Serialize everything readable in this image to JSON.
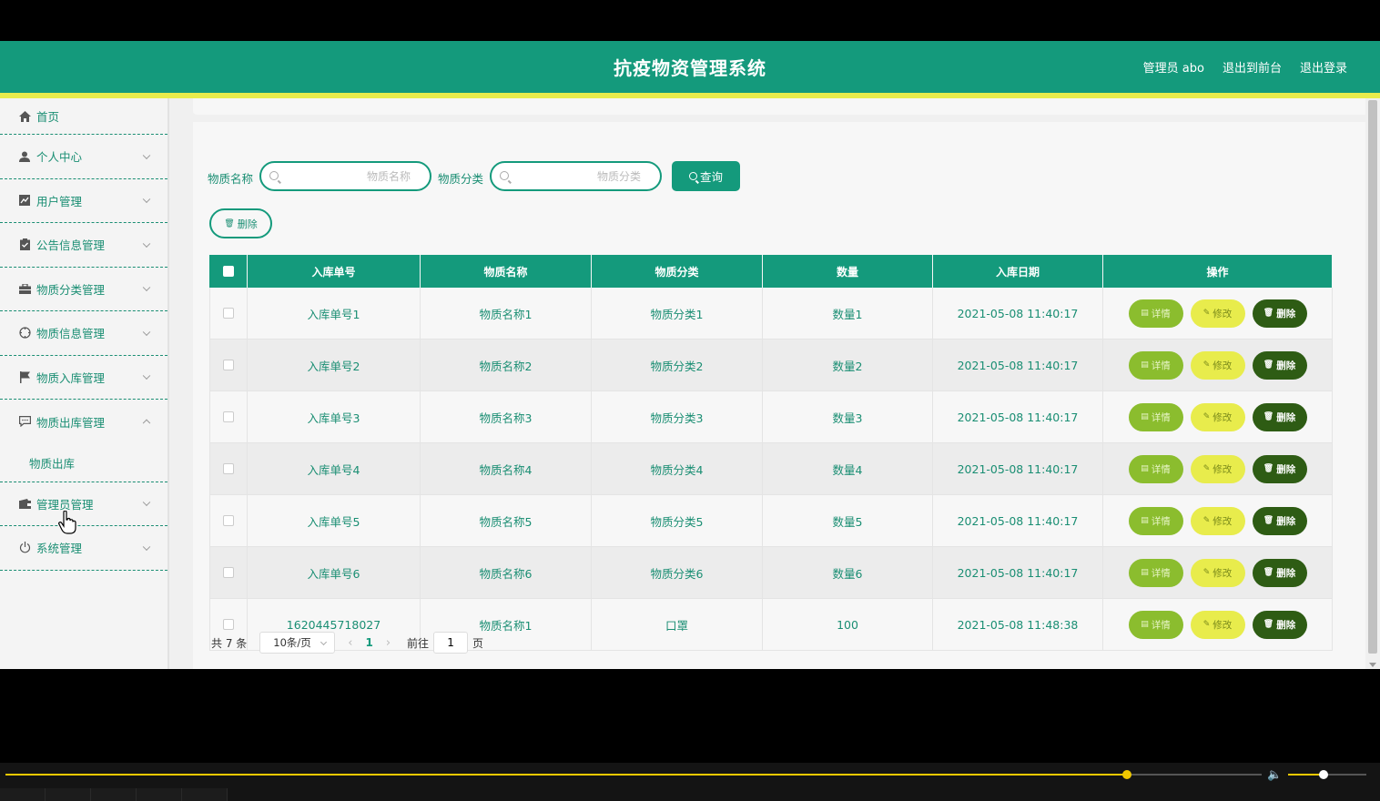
{
  "header": {
    "title": "抗疫物资管理系统",
    "user_label": "管理员 abo",
    "front_link": "退出到前台",
    "logout_link": "退出登录",
    "colors": {
      "primary": "#149a7c",
      "accent": "#e8ec4c"
    }
  },
  "sidebar": {
    "items": [
      {
        "label": "首页",
        "icon": "home-icon"
      },
      {
        "label": "个人中心",
        "icon": "user-icon"
      },
      {
        "label": "用户管理",
        "icon": "chart-icon"
      },
      {
        "label": "公告信息管理",
        "icon": "clipboard-icon"
      },
      {
        "label": "物质分类管理",
        "icon": "briefcase-icon"
      },
      {
        "label": "物质信息管理",
        "icon": "compass-icon"
      },
      {
        "label": "物质入库管理",
        "icon": "flag-icon"
      },
      {
        "label": "物质出库管理",
        "icon": "comment-icon"
      },
      {
        "label": "管理员管理",
        "icon": "wallet-icon"
      },
      {
        "label": "系统管理",
        "icon": "power-icon"
      }
    ],
    "sub_item": "物质出库"
  },
  "search": {
    "name_label": "物质名称",
    "name_placeholder": "物质名称",
    "category_label": "物质分类",
    "category_placeholder": "物质分类",
    "query_button": "查询"
  },
  "bulk_delete": "删除",
  "table": {
    "headers": [
      "入库单号",
      "物质名称",
      "物质分类",
      "数量",
      "入库日期",
      "操作"
    ],
    "rows": [
      [
        "入库单号1",
        "物质名称1",
        "物质分类1",
        "数量1",
        "2021-05-08 11:40:17"
      ],
      [
        "入库单号2",
        "物质名称2",
        "物质分类2",
        "数量2",
        "2021-05-08 11:40:17"
      ],
      [
        "入库单号3",
        "物质名称3",
        "物质分类3",
        "数量3",
        "2021-05-08 11:40:17"
      ],
      [
        "入库单号4",
        "物质名称4",
        "物质分类4",
        "数量4",
        "2021-05-08 11:40:17"
      ],
      [
        "入库单号5",
        "物质名称5",
        "物质分类5",
        "数量5",
        "2021-05-08 11:40:17"
      ],
      [
        "入库单号6",
        "物质名称6",
        "物质分类6",
        "数量6",
        "2021-05-08 11:40:17"
      ],
      [
        "1620445718027",
        "物质名称1",
        "口罩",
        "100",
        "2021-05-08 11:48:38"
      ]
    ],
    "actions": {
      "detail": "详情",
      "edit": "修改",
      "delete": "删除"
    }
  },
  "pagination": {
    "total": "共 7 条",
    "page_size": "10条/页",
    "current_page": "1",
    "goto_prefix": "前往",
    "goto_value": "1",
    "goto_suffix": "页"
  },
  "video": {
    "progress": 0.893,
    "volume": 0.45
  }
}
